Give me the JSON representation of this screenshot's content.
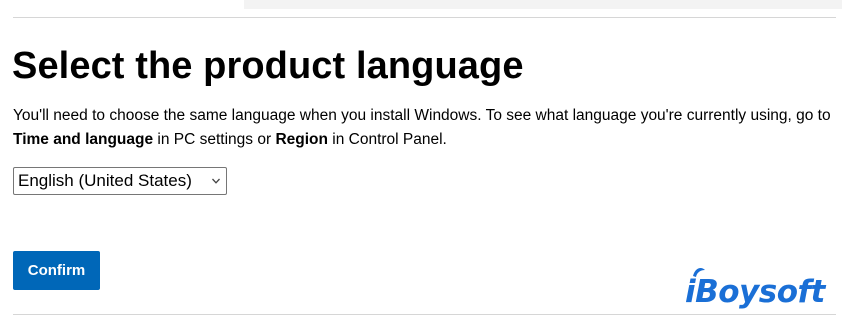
{
  "page": {
    "title": "Select the product language",
    "instructions": {
      "part1": "You'll need to choose the same language when you install Windows. To see what language you're currently using, go to ",
      "bold1": "Time and language",
      "part2": " in PC settings or ",
      "bold2": "Region",
      "part3": " in Control Panel."
    }
  },
  "language_select": {
    "selected": "English (United States)",
    "icon": "chevron-down-icon"
  },
  "confirm_button": {
    "label": "Confirm"
  },
  "watermark": {
    "text": "iBoysoft"
  },
  "colors": {
    "accent": "#0067b8",
    "watermark": "#1a6fd6"
  }
}
